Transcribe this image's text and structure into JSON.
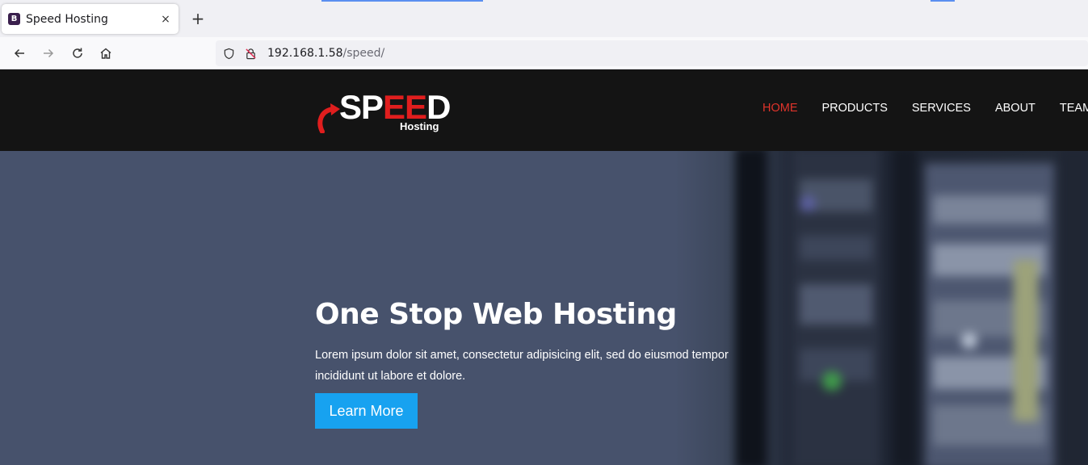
{
  "browser": {
    "tab": {
      "favicon_letter": "B",
      "title": "Speed Hosting",
      "close_glyph": "×"
    },
    "new_tab_glyph": "+",
    "url": {
      "host": "192.168.1.58",
      "path": "/speed/"
    },
    "icons": [
      "back-icon",
      "forward-icon",
      "reload-icon",
      "home-icon",
      "shield-icon",
      "insecure-lock-icon"
    ]
  },
  "site": {
    "logo": {
      "text_white_1": "SP",
      "text_red": "EE",
      "text_white_2": "D",
      "subtitle": "Hosting"
    },
    "menu": [
      {
        "label": "HOME",
        "active": true
      },
      {
        "label": "PRODUCTS",
        "active": false
      },
      {
        "label": "SERVICES",
        "active": false
      },
      {
        "label": "ABOUT",
        "active": false
      },
      {
        "label": "TEAM",
        "active": false
      }
    ],
    "hero": {
      "title": "One Stop Web Hosting",
      "text": "Lorem ipsum dolor sit amet, consectetur adipisicing elit, sed do eiusmod tempor incididunt ut labore et dolore.",
      "button_label": "Learn More"
    }
  },
  "colors": {
    "header_bg": "#141414",
    "menu_active": "#e0342b",
    "logo_red": "#e01e1e",
    "hero_bg": "#47526c",
    "button_bg": "#17a2f0"
  }
}
